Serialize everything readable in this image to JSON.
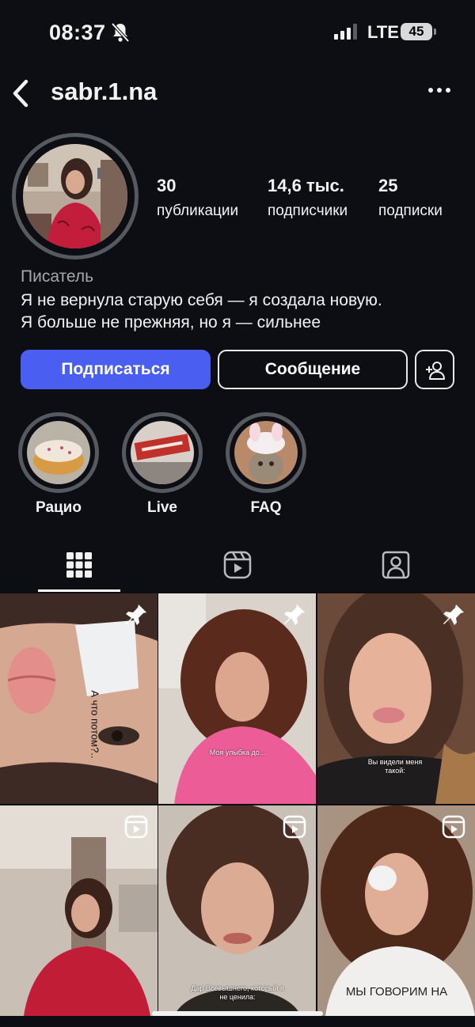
{
  "status_bar": {
    "time": "08:37",
    "network": "LTE",
    "battery": "45",
    "icons": [
      "bell-slash-icon",
      "cellular-signal-icon",
      "battery-icon"
    ]
  },
  "header": {
    "username": "sabr.1.na",
    "back_icon": "chevron-left-icon",
    "menu_icon": "ellipsis-icon"
  },
  "profile": {
    "stats": [
      {
        "value": "30",
        "label": "публикации"
      },
      {
        "value": "14,6 тыс.",
        "label": "подписчики"
      },
      {
        "value": "25",
        "label": "подписки"
      }
    ],
    "bio": {
      "category": "Писатель",
      "lines": [
        "Я не вернула старую себя — я создала новую.",
        "Я больше не прежняя, но я — сильнее"
      ]
    }
  },
  "actions": {
    "follow_label": "Подписаться",
    "message_label": "Сообщение",
    "add_user_icon": "add-person-icon"
  },
  "highlights": [
    {
      "label": "Рацио"
    },
    {
      "label": "Live"
    },
    {
      "label": "FAQ"
    }
  ],
  "tabs": [
    {
      "name": "posts",
      "icon": "grid-icon",
      "active": true
    },
    {
      "name": "reels",
      "icon": "reels-icon",
      "active": false
    },
    {
      "name": "tagged",
      "icon": "tagged-person-icon",
      "active": false
    }
  ],
  "grid": {
    "posts": [
      {
        "overlay": "pin-icon",
        "caption": "А что потом?.."
      },
      {
        "overlay": "pin-icon",
        "caption": "Моя улыбка до..."
      },
      {
        "overlay": "pin-icon",
        "caption": "Вы видели меня такой:"
      },
      {
        "overlay": "reel-icon",
        "caption": ""
      },
      {
        "overlay": "reel-icon",
        "caption": "Дар Всевышнего, который я не ценила:"
      },
      {
        "overlay": "reel-icon",
        "caption": "МЫ ГОВОРИМ НА"
      }
    ]
  },
  "colors": {
    "background": "#0c0e13",
    "accent": "#4a5ef2",
    "ring": "#555960",
    "muted_text": "#a4a7ad"
  }
}
